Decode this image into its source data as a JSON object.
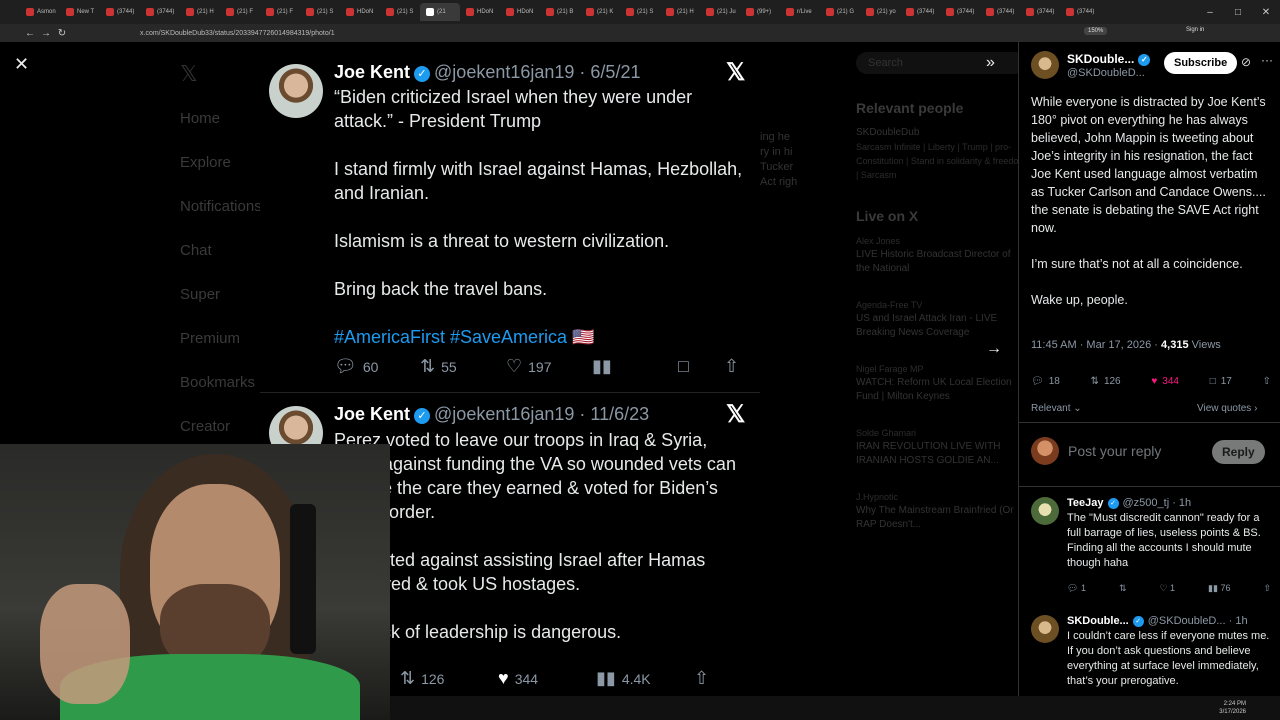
{
  "browser": {
    "tabs": [
      {
        "label": "Asmon",
        "active": false
      },
      {
        "label": "New T",
        "active": false
      },
      {
        "label": "(3744)",
        "active": false
      },
      {
        "label": "(3744)",
        "active": false
      },
      {
        "label": "(21) H",
        "active": false
      },
      {
        "label": "(21) F",
        "active": false
      },
      {
        "label": "(21) F",
        "active": false
      },
      {
        "label": "(21) S",
        "active": false
      },
      {
        "label": "HDoN",
        "active": false
      },
      {
        "label": "(21) S",
        "active": false
      },
      {
        "label": "(21",
        "active": true
      },
      {
        "label": "HDoN",
        "active": false
      },
      {
        "label": "HDoN",
        "active": false
      },
      {
        "label": "(21) B",
        "active": false
      },
      {
        "label": "(21) K",
        "active": false
      },
      {
        "label": "(21) S",
        "active": false
      },
      {
        "label": "(21) H",
        "active": false
      },
      {
        "label": "(21) Ju",
        "active": false
      },
      {
        "label": "(99+)",
        "active": false
      },
      {
        "label": "r/Live",
        "active": false
      },
      {
        "label": "(21) G",
        "active": false
      },
      {
        "label": "(21) yo",
        "active": false
      },
      {
        "label": "(3744)",
        "active": false
      },
      {
        "label": "(3744)",
        "active": false
      },
      {
        "label": "(3744)",
        "active": false
      },
      {
        "label": "(3744)",
        "active": false
      },
      {
        "label": "(3744)",
        "active": false
      }
    ],
    "url": "x.com/SKDoubleDub33/status/2033947726014984319/photo/1",
    "zoom": "150%",
    "signin": "Sign in"
  },
  "background": {
    "nav": [
      "Home",
      "Explore",
      "Notifications",
      "Chat",
      "Super",
      "Premium",
      "Bookmarks",
      "Creator"
    ],
    "center_snippet": "ing he\nry in hi\nTucker\nAct righ",
    "search_placeholder": "Search",
    "relevant_title": "Relevant people",
    "relevant_name": "SKDoubleDub",
    "relevant_bio": "Sarcasm Infinite | Liberty | Trump | pro-Constitution | Stand in solidarity & freedom | Sarcasm",
    "live_title": "Live on X",
    "live_items": [
      {
        "host": "Alex Jones",
        "title": "LIVE Historic Broadcast Director of the National"
      },
      {
        "host": "Agenda-Free TV",
        "title": "US and Israel Attack Iran - LIVE Breaking News Coverage"
      },
      {
        "host": "Nigel Farage MP",
        "title": "WATCH: Reform UK Local Election Fund | Milton Keynes"
      },
      {
        "host": "Solde Ghamari",
        "title": "IRAN REVOLUTION LIVE WITH IRANIAN HOSTS GOLDIE AN..."
      },
      {
        "host": "J.Hypnotic",
        "title": "Why The Mainstream Brainfried (Or RAP Doesn't..."
      }
    ]
  },
  "viewer": {
    "tweets": [
      {
        "name": "Joe Kent",
        "handle": "@joekent16jan19",
        "date": "6/5/21",
        "paragraphs": [
          "“Biden criticized Israel when they were under attack.” - President Trump",
          "I stand firmly with Israel against Hamas, Hezbollah, and Iranian.",
          "Islamism is a threat to western civilization.",
          "Bring back the travel bans."
        ],
        "hashtags": "#AmericaFirst #SaveAmerica 🇺🇸",
        "replies": "60",
        "reposts": "55",
        "likes": "197"
      },
      {
        "name": "Joe Kent",
        "handle": "@joekent16jan19",
        "date": "11/6/23",
        "paragraphs": [
          "Perez voted to leave our troops in Iraq & Syria, voted against funding the VA so wounded vets can receive the care they earned & voted for Biden’s open border.",
          "She voted against assisting Israel after Hamas murdered & took US hostages.",
          "Her lack of leadership is dangerous."
        ],
        "reposts": "126",
        "likes": "344",
        "views": "4.4K"
      }
    ]
  },
  "post": {
    "author_name": "SKDouble...",
    "author_handle": "@SKDoubleD...",
    "subscribe_label": "Subscribe",
    "paragraphs": [
      "While everyone is distracted by Joe Kent’s 180° pivot on everything he has always believed, John Mappin is tweeting about Joe’s integrity in his resignation, the fact Joe Kent used language almost verbatim as Tucker Carlson and Candace Owens.... the senate is debating the SAVE Act right now.",
      "I’m sure that’s not at all a coincidence.",
      "Wake up, people."
    ],
    "timestamp": "11:45 AM · Mar 17, 2026 ·",
    "views_count": "4,315",
    "views_label": "Views",
    "replies": "18",
    "reposts": "126",
    "likes": "344",
    "bookmarks": "17",
    "sort_label": "Relevant",
    "view_quotes_label": "View quotes",
    "reply_placeholder": "Post your reply",
    "reply_button": "Reply"
  },
  "replies": [
    {
      "name": "TeeJay",
      "handle": "@z500_tj",
      "time": "· 1h",
      "text": "The \"Must discredit cannon\" ready for a full barrage of lies, useless points & BS.  Finding all the accounts I should mute though haha",
      "replies": "1",
      "likes": "1",
      "views": "76"
    },
    {
      "name": "SKDouble...",
      "handle": "@SKDoubleD...",
      "time": "· 1h",
      "text": "I couldn’t care less if everyone mutes me. If you don’t ask questions and believe everything at surface level immediately, that’s your prerogative."
    }
  ],
  "system": {
    "time": "2:24 PM",
    "date": "3/17/2026"
  },
  "colors": {
    "accent": "#1d9bf0",
    "like": "#f91880",
    "shirt": "#2f9a49"
  }
}
